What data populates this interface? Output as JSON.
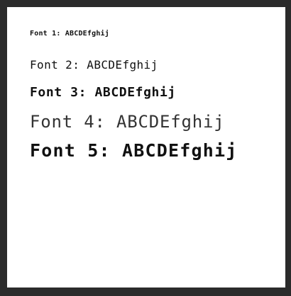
{
  "screen": {
    "lines": [
      {
        "label": "Font 1:",
        "sample": "ABCDEfghij"
      },
      {
        "label": "Font 2:",
        "sample": "ABCDEfghij"
      },
      {
        "label": "Font 3:",
        "sample": "ABCDEfghij"
      },
      {
        "label": "Font 4:",
        "sample": "ABCDEfghij"
      },
      {
        "label": "Font 5:",
        "sample": "ABCDEfghij"
      }
    ]
  },
  "colors": {
    "frame": "#2b2b2b",
    "background": "#ffffff",
    "text": "#111111"
  }
}
